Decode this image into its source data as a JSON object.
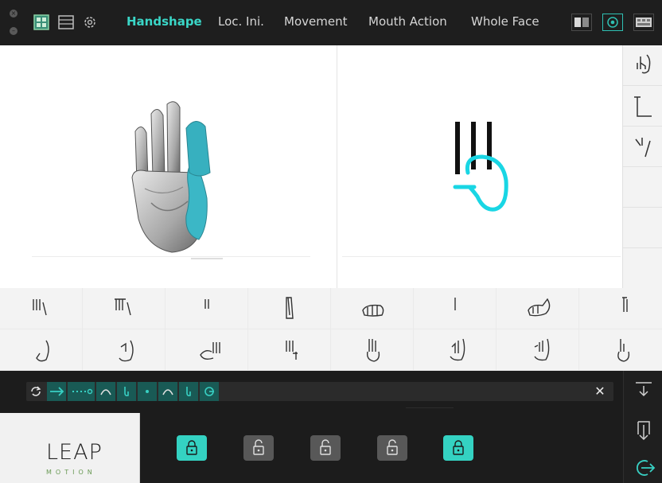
{
  "tabs": [
    {
      "label": "Handshape",
      "active": true
    },
    {
      "label": "Loc. Ini.",
      "active": false
    },
    {
      "label": "Movement",
      "active": false
    },
    {
      "label": "Mouth Action",
      "active": false
    },
    {
      "label": "Whole Face",
      "active": false
    }
  ],
  "toolbar_icons": [
    "grid-view-icon",
    "list-view-icon",
    "settings-icon"
  ],
  "view_buttons": [
    {
      "icon": "split-view-icon",
      "active": false
    },
    {
      "icon": "target-view-icon",
      "active": true
    },
    {
      "icon": "keyboard-view-icon",
      "active": false
    }
  ],
  "sequence": {
    "icons": [
      "refresh-icon",
      "arrow-right-icon",
      "dotted-arrow-icon",
      "arc-icon",
      "hook-icon",
      "dot-icon",
      "arc-icon",
      "hook-icon",
      "circle-arrow-icon"
    ],
    "close_label": "✕"
  },
  "locks": [
    {
      "state": "locked",
      "active": true
    },
    {
      "state": "unlocked",
      "active": false
    },
    {
      "state": "unlocked",
      "active": false
    },
    {
      "state": "unlocked",
      "active": false
    },
    {
      "state": "locked",
      "active": true
    }
  ],
  "side_actions": [
    "collapse-icon",
    "export-icon",
    "exit-icon"
  ],
  "logo": {
    "main": "LEAP",
    "sub": "MOTION"
  },
  "colors": {
    "accent": "#34d2c2",
    "dark": "#1c1c1c"
  }
}
